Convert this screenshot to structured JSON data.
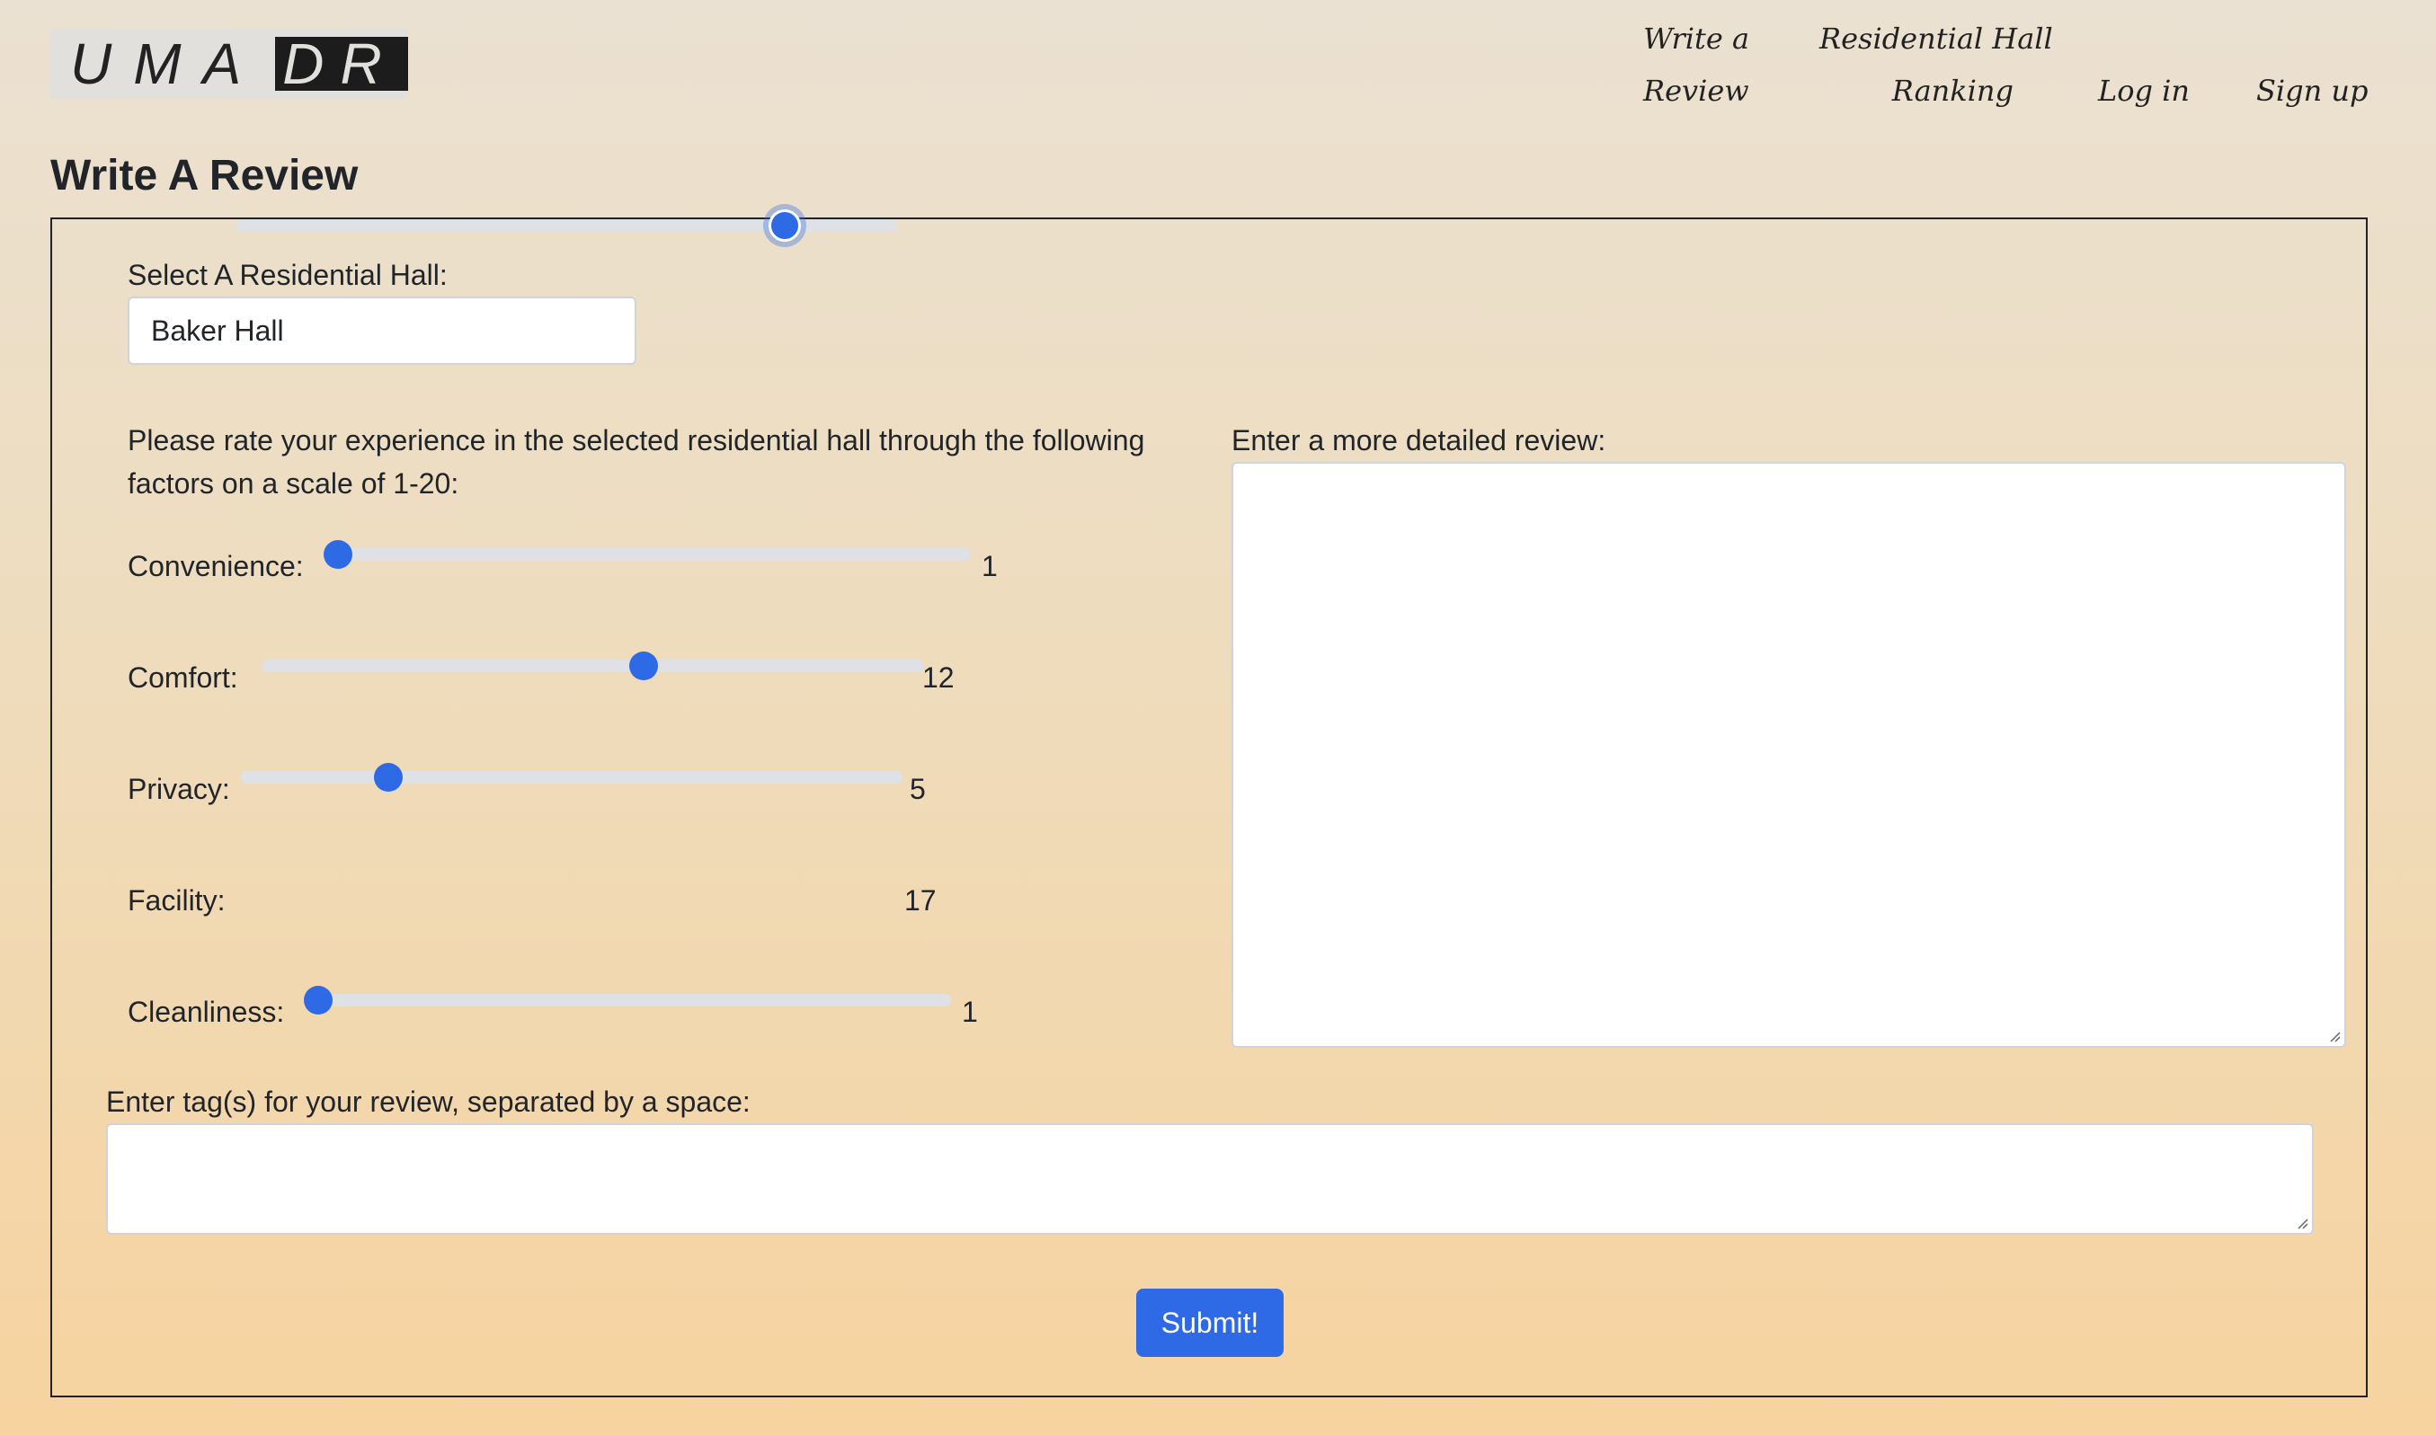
{
  "logo": {
    "left": "UMA",
    "right": "DR"
  },
  "nav": {
    "write_review_line1": "Write a",
    "write_review_line2": "Review",
    "ranking_line1": "Residential Hall",
    "ranking_line2": "Ranking",
    "login": "Log in",
    "signup": "Sign up"
  },
  "page_title": "Write A Review",
  "form": {
    "hall_label": "Select A Residential Hall:",
    "hall_value": "Baker Hall",
    "rating_intro_line1": "Please rate your experience in the selected residential hall through the following",
    "rating_intro_line2": "factors on a scale of 1-20:",
    "sliders": [
      {
        "label": "Convenience:",
        "value": "1",
        "min": 1,
        "max": 20
      },
      {
        "label": "Comfort:",
        "value": "12",
        "min": 1,
        "max": 20
      },
      {
        "label": "Privacy:",
        "value": "5",
        "min": 1,
        "max": 20
      },
      {
        "label": "Facility:",
        "value": "17",
        "min": 1,
        "max": 20
      },
      {
        "label": "Cleanliness:",
        "value": "1",
        "min": 1,
        "max": 20
      }
    ],
    "review_label": "Enter a more detailed review:",
    "review_value": "",
    "tags_label": "Enter tag(s) for your review, separated by a space:",
    "tags_value": "",
    "submit_label": "Submit!"
  },
  "colors": {
    "accent": "#2f6ae6",
    "track": "#dee2e6"
  }
}
